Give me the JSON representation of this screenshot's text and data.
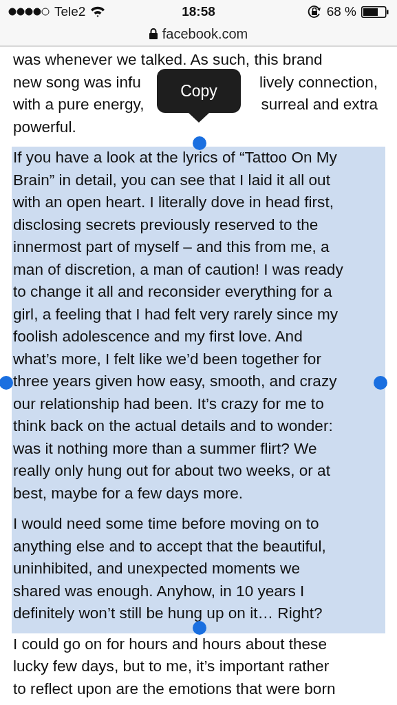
{
  "status_bar": {
    "carrier": "Tele2",
    "time": "18:58",
    "battery": "68 %"
  },
  "address_bar": {
    "url": "facebook.com"
  },
  "copy_menu": {
    "label": "Copy"
  },
  "paragraphs": [
    {
      "selected": false,
      "lines": [
        [
          "was whenever we talked. As such, this brand"
        ],
        [
          "new song was infu",
          "lively connection,"
        ],
        [
          "with a pure energy,",
          "surreal and extra"
        ],
        [
          "powerful."
        ]
      ]
    },
    {
      "selected": true,
      "lines": [
        [
          "If you have a look at the lyrics of “Tattoo On My"
        ],
        [
          "Brain” in detail, you can see that I laid it all out"
        ],
        [
          "with an open heart. I literally dove in head first,"
        ],
        [
          "disclosing secrets previously reserved to the"
        ],
        [
          "innermost part of myself – and this from me, a"
        ],
        [
          "man of discretion, a man of caution! I was ready"
        ],
        [
          "to change it all and reconsider everything for a"
        ],
        [
          "girl, a feeling that I had felt very rarely since my"
        ],
        [
          "foolish adolescence and my first love. And"
        ],
        [
          "what’s more, I felt like we’d been together for"
        ],
        [
          "three years given how easy, smooth, and crazy"
        ],
        [
          "our relationship had been. It’s crazy for me to"
        ],
        [
          "think back on the actual details and to wonder:"
        ],
        [
          "was it nothing more than a summer flirt? We"
        ],
        [
          "really only hung out for about two weeks, or at"
        ],
        [
          "best, maybe for a few days more."
        ]
      ]
    },
    {
      "selected": true,
      "lines": [
        [
          "I would need some time before moving on to"
        ],
        [
          "anything else and to accept that the beautiful,"
        ],
        [
          "uninhibited, and unexpected moments we"
        ],
        [
          "shared was enough. Anyhow, in 10 years I"
        ],
        [
          "definitely won’t still be hung up on it… Right?"
        ]
      ]
    },
    {
      "selected": false,
      "lines": [
        [
          "I could go on for hours and hours about these"
        ],
        [
          "lucky few days, but to me, it’s important rather"
        ],
        [
          "to reflect upon are the emotions that were born"
        ]
      ]
    }
  ]
}
